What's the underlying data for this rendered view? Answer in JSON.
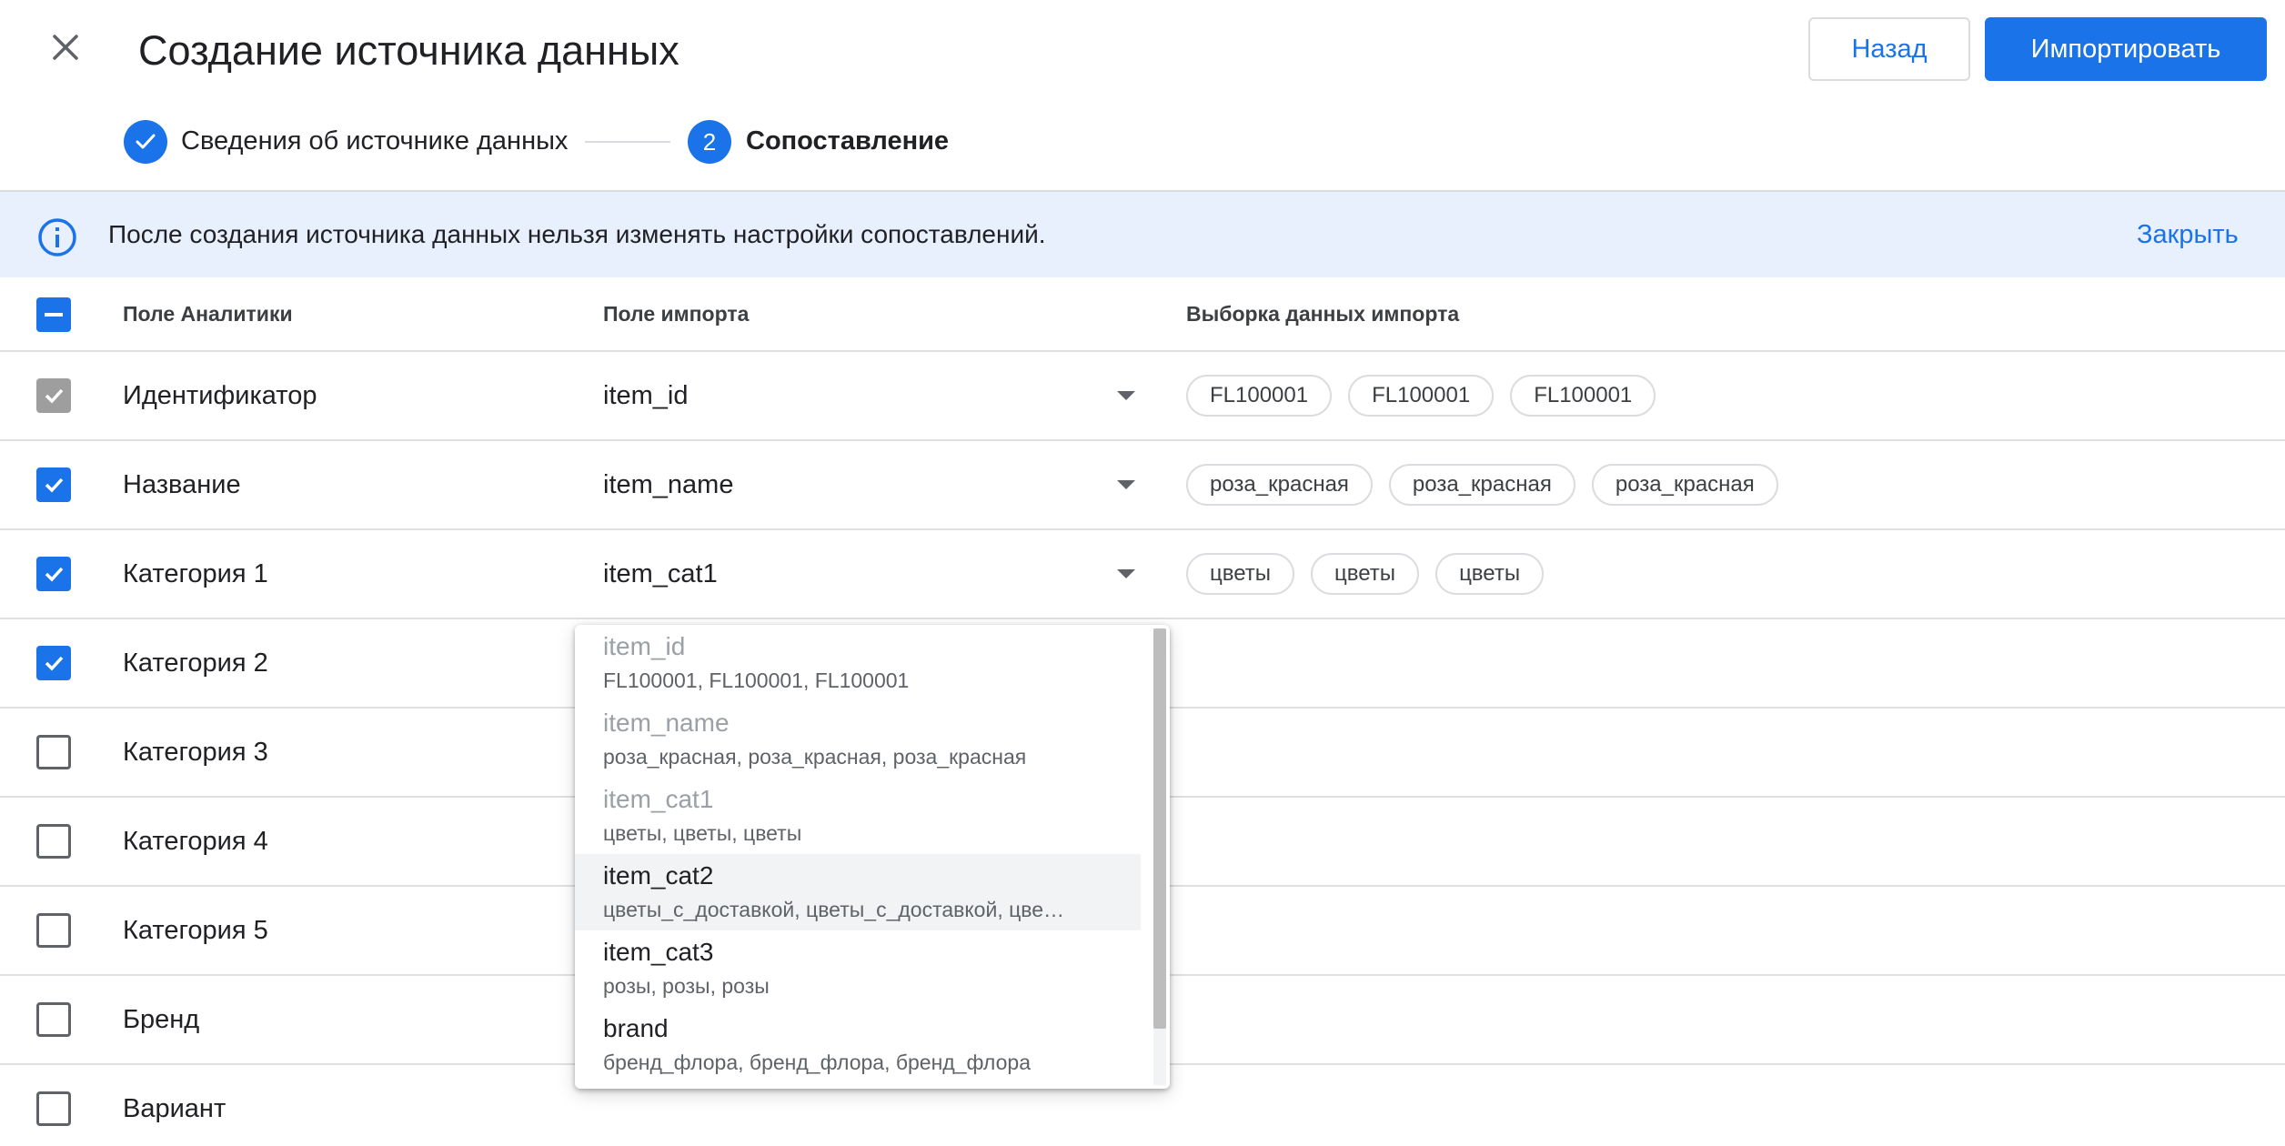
{
  "header": {
    "title": "Создание источника данных",
    "back_label": "Назад",
    "import_label": "Импортировать"
  },
  "stepper": {
    "step1_label": "Сведения об источнике данных",
    "step2_number": "2",
    "step2_label": "Сопоставление"
  },
  "banner": {
    "text": "После создания источника данных нельзя изменять настройки сопоставлений.",
    "close_label": "Закрыть"
  },
  "table": {
    "headers": {
      "analytics_field": "Поле Аналитики",
      "import_field": "Поле импорта",
      "sample": "Выборка данных импорта"
    },
    "rows": [
      {
        "field": "Идентификатор",
        "checkbox": "disabled-checked",
        "import": "item_id",
        "samples": [
          "FL100001",
          "FL100001",
          "FL100001"
        ]
      },
      {
        "field": "Название",
        "checkbox": "checked",
        "import": "item_name",
        "samples": [
          "роза_красная",
          "роза_красная",
          "роза_красная"
        ]
      },
      {
        "field": "Категория 1",
        "checkbox": "checked",
        "import": "item_cat1",
        "samples": [
          "цветы",
          "цветы",
          "цветы"
        ]
      },
      {
        "field": "Категория 2",
        "checkbox": "checked",
        "import": "",
        "samples": []
      },
      {
        "field": "Категория 3",
        "checkbox": "unchecked",
        "import": "",
        "samples": []
      },
      {
        "field": "Категория 4",
        "checkbox": "unchecked",
        "import": "",
        "samples": []
      },
      {
        "field": "Категория 5",
        "checkbox": "unchecked",
        "import": "",
        "samples": []
      },
      {
        "field": "Бренд",
        "checkbox": "unchecked",
        "import": "",
        "samples": []
      },
      {
        "field": "Вариант",
        "checkbox": "unchecked",
        "import": "",
        "samples": []
      }
    ]
  },
  "dropdown": {
    "options": [
      {
        "name": "item_id",
        "sample": "FL100001, FL100001, FL100001",
        "state": "used"
      },
      {
        "name": "item_name",
        "sample": "роза_красная, роза_красная, роза_красная",
        "state": "used"
      },
      {
        "name": "item_cat1",
        "sample": "цветы, цветы, цветы",
        "state": "used"
      },
      {
        "name": "item_cat2",
        "sample": "цветы_с_доставкой, цветы_с_доставкой, цве…",
        "state": "highlighted"
      },
      {
        "name": "item_cat3",
        "sample": "розы, розы, розы",
        "state": "normal"
      },
      {
        "name": "brand",
        "sample": "бренд_флора, бренд_флора, бренд_флора",
        "state": "normal"
      }
    ]
  },
  "icons": {
    "close": "close-icon",
    "step_done": "check-icon",
    "info": "info-icon",
    "dropdown": "arrow-drop-down-icon"
  },
  "colors": {
    "accent": "#1a73e8",
    "banner_bg": "#e8f0fe",
    "disabled": "#9e9e9e"
  }
}
